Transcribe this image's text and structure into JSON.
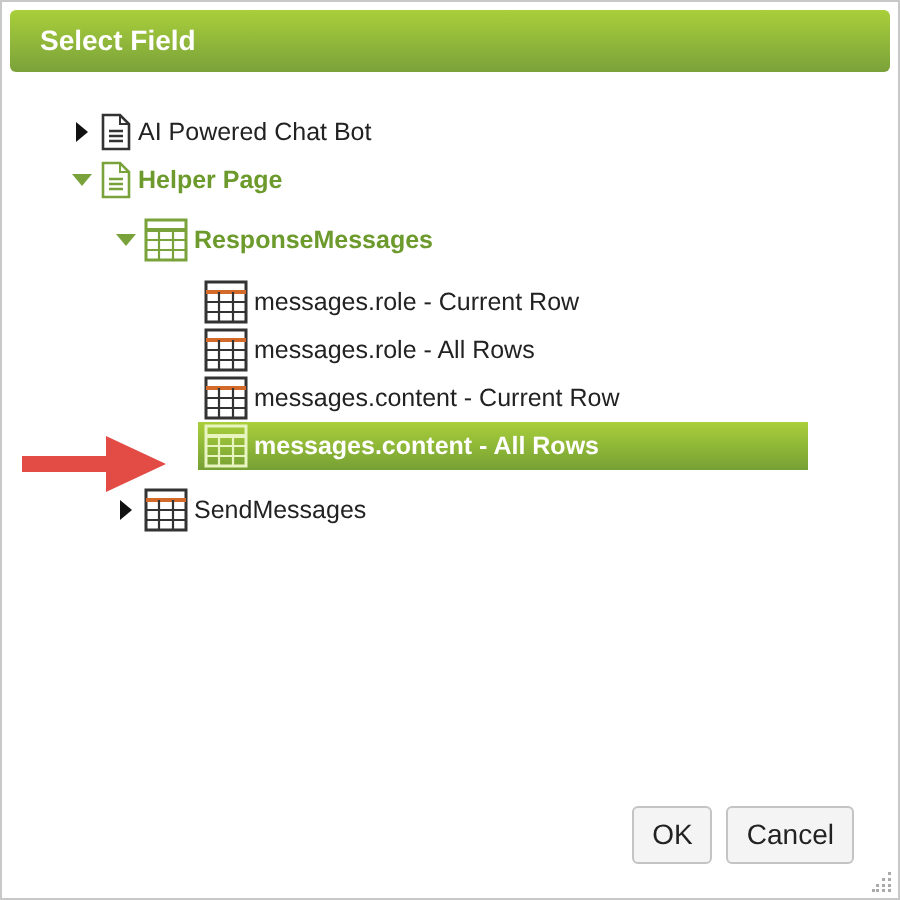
{
  "dialog": {
    "title": "Select Field"
  },
  "tree": [
    {
      "label": "AI Powered Chat Bot",
      "kind": "page",
      "expanded": false,
      "selected": false
    },
    {
      "label": "Helper Page",
      "kind": "page",
      "expanded": true,
      "selected": false,
      "children": [
        {
          "label": "ResponseMessages",
          "kind": "table",
          "expanded": true,
          "selected": false,
          "children": [
            {
              "label": "messages.role - Current Row",
              "kind": "field",
              "selected": false
            },
            {
              "label": "messages.role - All Rows",
              "kind": "field",
              "selected": false
            },
            {
              "label": "messages.content - Current Row",
              "kind": "field",
              "selected": false
            },
            {
              "label": "messages.content - All Rows",
              "kind": "field",
              "selected": true
            }
          ]
        },
        {
          "label": "SendMessages",
          "kind": "table",
          "expanded": false,
          "selected": false
        }
      ]
    }
  ],
  "buttons": [
    "OK",
    "Cancel"
  ]
}
